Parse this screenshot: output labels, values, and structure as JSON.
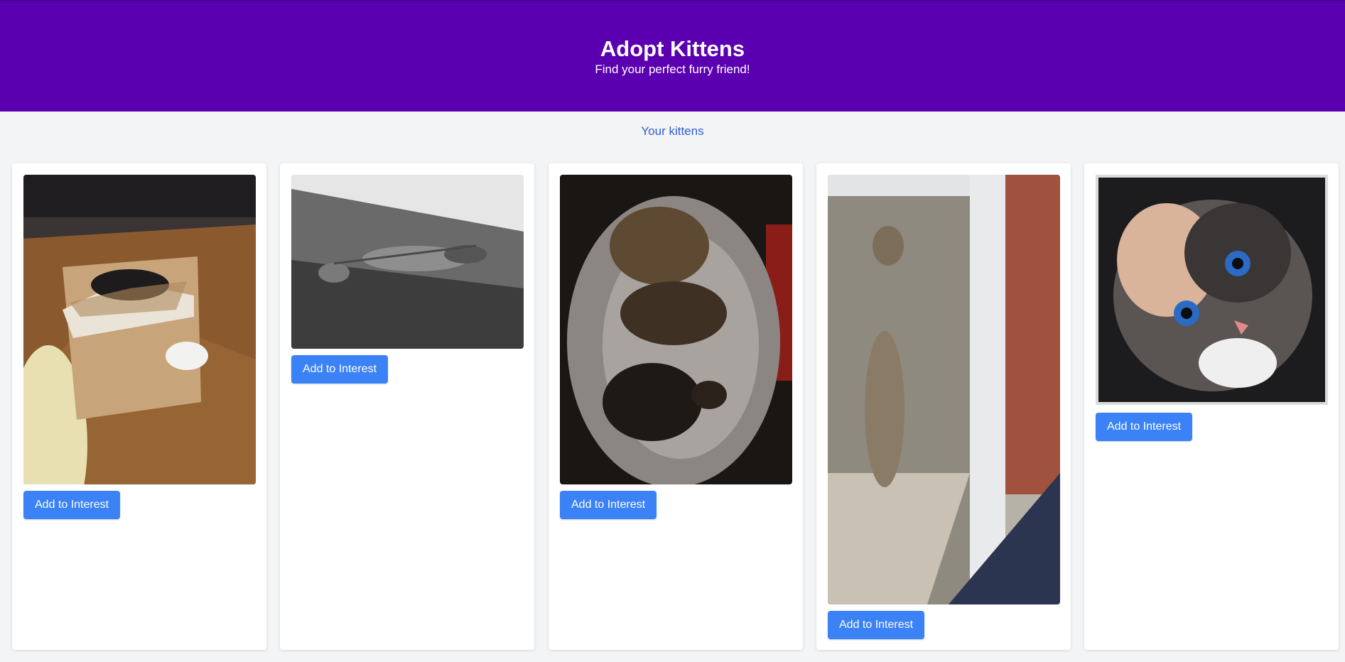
{
  "header": {
    "title": "Adopt Kittens",
    "subtitle": "Find your perfect furry friend!"
  },
  "nav": {
    "your_kittens_link": "Your kittens"
  },
  "cards": [
    {
      "photo": "kitten-photo-cats-in-cardboard-box",
      "button_label": "Add to Interest"
    },
    {
      "photo": "kitten-photo-tabby-stretched-on-table",
      "button_label": "Add to Interest"
    },
    {
      "photo": "kitten-photo-cats-in-pet-bed",
      "button_label": "Add to Interest"
    },
    {
      "photo": "kitten-photo-cat-standing-at-window",
      "button_label": "Add to Interest"
    },
    {
      "photo": "kitten-photo-calico-closeup",
      "button_label": "Add to Interest"
    }
  ],
  "colors": {
    "header_bg": "#5b00b0",
    "button_bg": "#3b82f6",
    "link": "#2f5fd0",
    "page_bg": "#f3f4f6"
  }
}
